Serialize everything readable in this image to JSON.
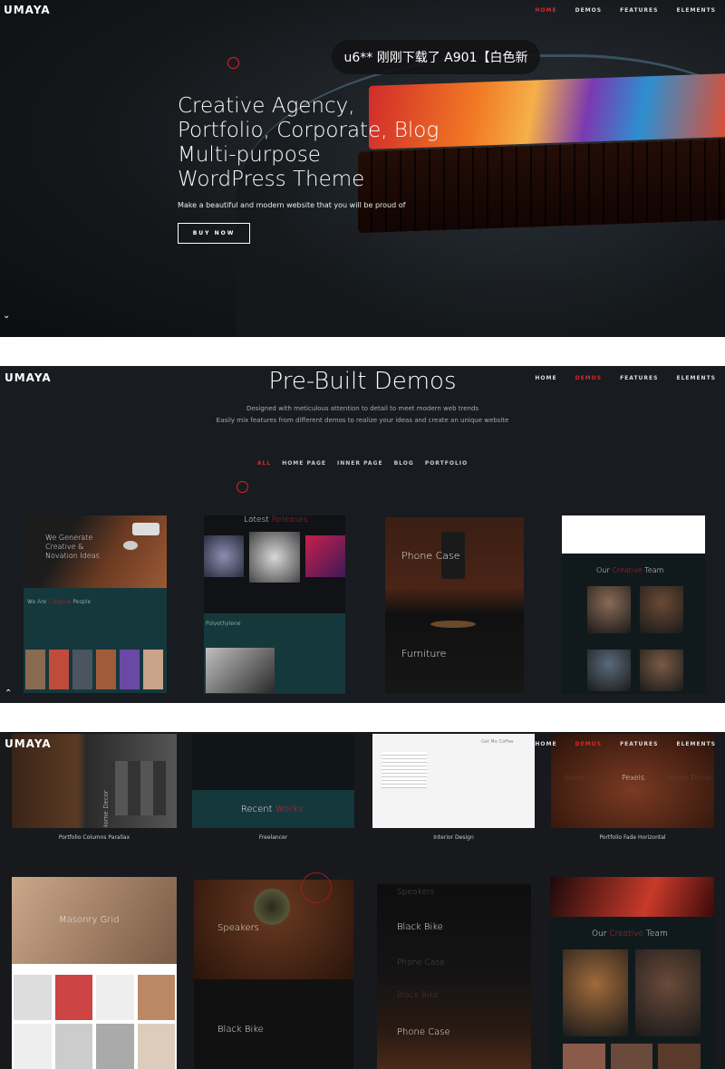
{
  "brand": {
    "logo": "UMAYA"
  },
  "nav": [
    {
      "label": "HOME",
      "active": true
    },
    {
      "label": "DEMOS",
      "active": false
    },
    {
      "label": "FEATURES",
      "active": false
    },
    {
      "label": "ELEMENTS",
      "active": false
    }
  ],
  "hero": {
    "notice": "u6** 刚刚下载了 A901【白色新",
    "title": "Creative Agency,\nPortfolio, Corporate, Blog\nMulti-purpose\nWordPress Theme",
    "subtitle": "Make a beautiful and modern website that you will be proud of",
    "cta": "BUY NOW",
    "scroll_icon": "chevron-down-icon"
  },
  "demos": {
    "nav": [
      {
        "label": "HOME",
        "active": false
      },
      {
        "label": "DEMOS",
        "active": true
      },
      {
        "label": "FEATURES",
        "active": false
      },
      {
        "label": "ELEMENTS",
        "active": false
      }
    ],
    "title": "Pre-Built Demos",
    "desc_line1": "Designed with meticulous attention to detail to meet modern web trends",
    "desc_line2": "Easily mix features from different demos to realize your ideas and create an unique website",
    "filters": [
      {
        "label": "ALL",
        "active": true
      },
      {
        "label": "HOME PAGE",
        "active": false
      },
      {
        "label": "INNER PAGE",
        "active": false
      },
      {
        "label": "BLOG",
        "active": false
      },
      {
        "label": "PORTFOLIO",
        "active": false
      }
    ],
    "thumb1": {
      "heading": "We Generate Creative & Novation Ideas",
      "sub_a": "We Are ",
      "sub_b": "Creative",
      "sub_c": " People"
    },
    "thumb2": {
      "heading_a": "Latest ",
      "heading_b": "Releases",
      "sub": "Polyethylene"
    },
    "thumb3": {
      "top": "Phone Case",
      "bottom": "Furniture"
    },
    "thumb4": {
      "heading_a": "Our ",
      "heading_b": "Creative",
      "heading_c": " Team"
    },
    "scroll_icon": "chevron-up-icon"
  },
  "grid": {
    "nav": [
      {
        "label": "HOME",
        "active": false
      },
      {
        "label": "DEMOS",
        "active": true
      },
      {
        "label": "FEATURES",
        "active": false
      },
      {
        "label": "ELEMENTS",
        "active": false
      }
    ],
    "row1": [
      {
        "caption": "Portfolio Columns Parallax",
        "overlay": "Home Decor"
      },
      {
        "caption": "Freelancer",
        "overlay_a": "Recent ",
        "overlay_b": "Works"
      },
      {
        "caption": "Interior Design",
        "overlay": "Get Me Coffee"
      },
      {
        "caption": "Portfolio Fade Horizontal",
        "overlay": "Pexels",
        "left_text": "Home",
        "right_text": "Home Decor"
      }
    ],
    "row2": [
      {
        "overlay": "Masonry Grid"
      },
      {
        "overlay_top": "Speakers",
        "overlay_bottom": "Black Bike"
      },
      {
        "overlay_a": "Speakers",
        "overlay_b": "Black Bike",
        "overlay_c": "Phone Case",
        "overlay_d": "Black Bike",
        "overlay_e": "Phone Case"
      },
      {
        "heading_a": "Our ",
        "heading_b": "Creative",
        "heading_c": " Team"
      }
    ]
  },
  "colors": {
    "accent": "#e0242a",
    "bg_dark": "#181b1f",
    "teal": "#15383c"
  }
}
